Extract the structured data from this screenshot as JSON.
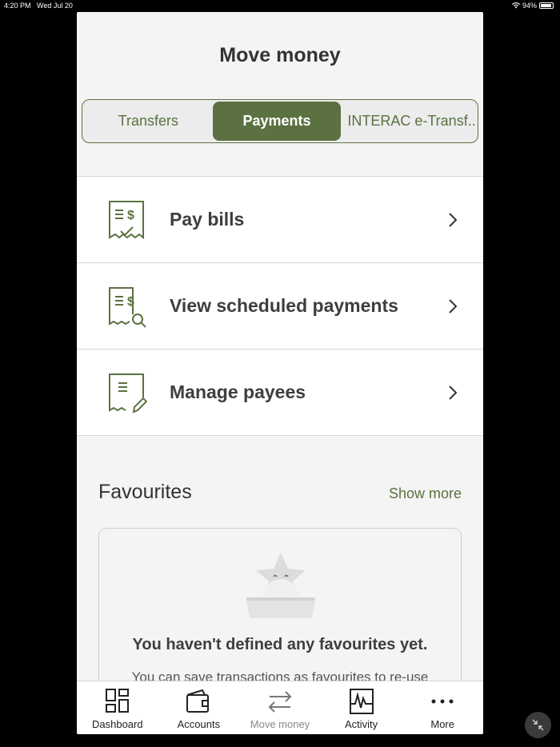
{
  "status": {
    "time": "4:20 PM",
    "date": "Wed Jul 20",
    "battery": "94%"
  },
  "title": "Move money",
  "segments": [
    {
      "label": "Transfers",
      "active": false
    },
    {
      "label": "Payments",
      "active": true
    },
    {
      "label": "INTERAC e-Transf...",
      "active": false
    }
  ],
  "rows": [
    {
      "label": "Pay bills",
      "icon": "bill-check-icon"
    },
    {
      "label": "View scheduled payments",
      "icon": "bill-search-icon"
    },
    {
      "label": "Manage payees",
      "icon": "document-edit-icon"
    }
  ],
  "favourites": {
    "title": "Favourites",
    "show_more": "Show more",
    "empty_title": "You haven't defined any favourites yet.",
    "empty_desc": "You can save transactions as favourites to re-use"
  },
  "tabs": [
    {
      "label": "Dashboard",
      "icon": "dashboard-icon"
    },
    {
      "label": "Accounts",
      "icon": "wallet-icon"
    },
    {
      "label": "Move money",
      "icon": "transfer-arrows-icon",
      "active": true
    },
    {
      "label": "Activity",
      "icon": "activity-icon"
    },
    {
      "label": "More",
      "icon": "more-dots-icon"
    }
  ],
  "colors": {
    "accent": "#5b7141",
    "background": "#f4f4f4"
  }
}
